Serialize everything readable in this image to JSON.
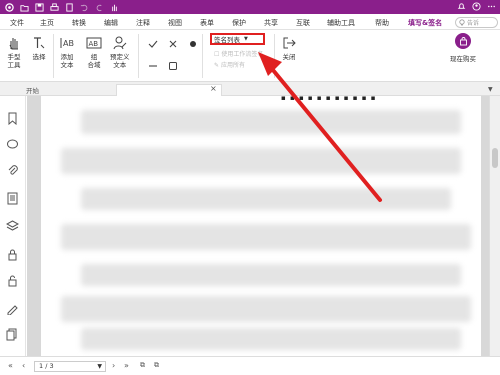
{
  "titlebar": {
    "color": "#8a1f8b"
  },
  "menu": {
    "items": [
      "文件",
      "主页",
      "转换",
      "编辑",
      "注释",
      "视图",
      "表单",
      "保护",
      "共享",
      "互联",
      "辅助工具",
      "帮助",
      "填写&签名"
    ],
    "active": "填写&签名",
    "search_placeholder": "告诉"
  },
  "ribbon": {
    "hand_tool": "手型\n工具",
    "select": "选择",
    "add_text": "添加\n文本",
    "combined_text": "组\n合域",
    "predefined_text": "预定义\n文本",
    "signature_list": "签名列表",
    "faint_1": "使用工作流签名",
    "faint_2": "应用所有",
    "close": "关闭",
    "buy_now": "现在购买"
  },
  "tabs": {
    "start": "开始"
  },
  "status": {
    "page_indicator": "1 / 3"
  },
  "colors": {
    "accent": "#8a1f8b",
    "highlight": "#e02020"
  }
}
